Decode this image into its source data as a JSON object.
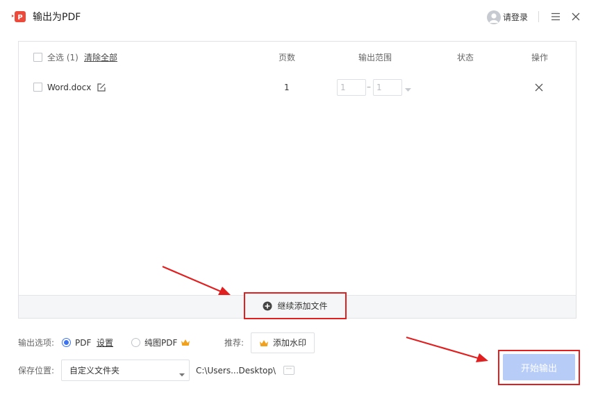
{
  "window": {
    "title": "输出为PDF",
    "login_label": "请登录",
    "icons": [
      "pdf-logo-icon",
      "user-avatar-icon",
      "menu-icon",
      "close-icon"
    ]
  },
  "file_list": {
    "select_all_label": "全选 (1)",
    "clear_all_label": "清除全部",
    "columns": [
      "页数",
      "输出范围",
      "状态",
      "操作"
    ],
    "rows": [
      {
        "name": "Word.docx",
        "pages": "1",
        "range_from": "1",
        "range_separator": "–",
        "range_to": "1",
        "status": ""
      }
    ],
    "add_more_label": "继续添加文件"
  },
  "options": {
    "output_label": "输出选项:",
    "pdf_label": "PDF",
    "settings_label": "设置",
    "image_pdf_label": "纯图PDF",
    "selected_format": "PDF",
    "recommend_label": "推荐:",
    "watermark_label": "添加水印",
    "save_label": "保存位置:",
    "folder_value": "自定义文件夹",
    "path_value": "C:\\Users...Desktop\\",
    "more_label": "···",
    "start_label": "开始输出"
  },
  "colors": {
    "accent": "#3b73f0",
    "highlight_red": "#e02020",
    "start_button": "#b7cdf8",
    "crown": "#f0a11e",
    "logo": "#ec4b3c"
  }
}
